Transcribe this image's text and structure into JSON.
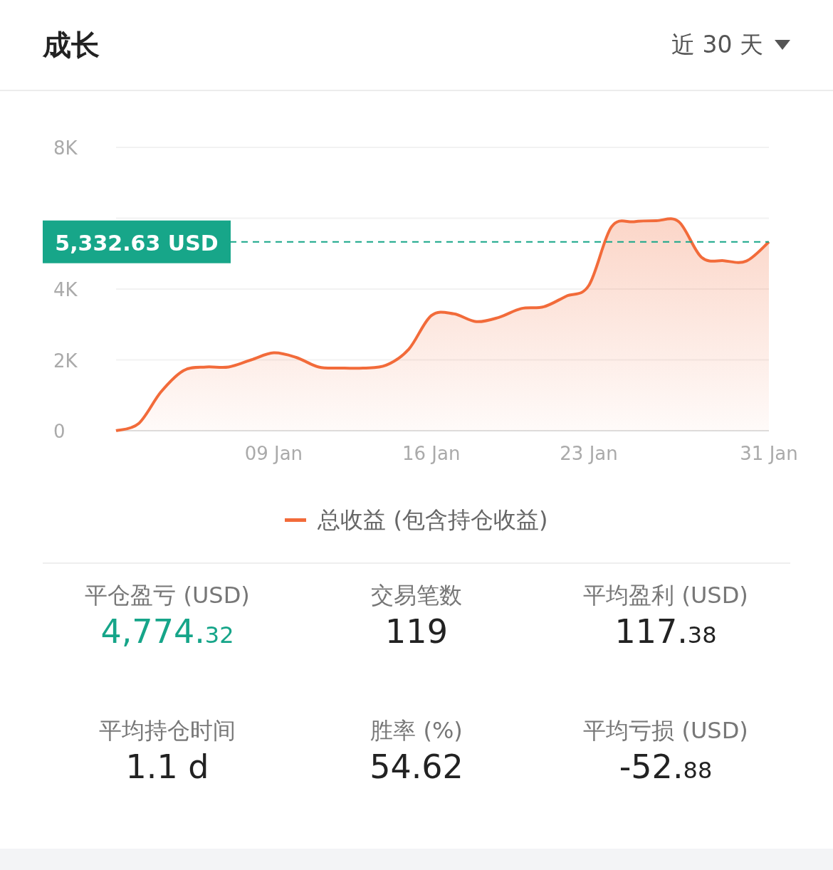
{
  "header": {
    "title": "成长",
    "period": "近 30 天"
  },
  "chart": {
    "chart_data": {
      "type": "area",
      "categories": [
        null,
        null,
        null,
        null,
        null,
        null,
        null,
        "09 Jan",
        null,
        null,
        null,
        null,
        null,
        null,
        "16 Jan",
        null,
        null,
        null,
        null,
        null,
        null,
        "23 Jan",
        null,
        null,
        null,
        null,
        null,
        null,
        null,
        "31 Jan"
      ],
      "series": [
        {
          "name": "总收益 (包含持仓收益)",
          "color": "#f26b3a",
          "values": [
            0,
            200,
            1100,
            1700,
            1800,
            1800,
            2000,
            2200,
            2070,
            1800,
            1770,
            1770,
            1850,
            2300,
            3250,
            3300,
            3080,
            3200,
            3450,
            3500,
            3800,
            4100,
            5750,
            5900,
            5930,
            5900,
            4900,
            4800,
            4790,
            5330
          ]
        }
      ],
      "ylim": [
        0,
        8000
      ],
      "yticks": [
        {
          "value": 0,
          "label": "0"
        },
        {
          "value": 2000,
          "label": "2K"
        },
        {
          "value": 4000,
          "label": "4K"
        },
        {
          "value": 8000,
          "label": "8K"
        }
      ],
      "ref_lines": [
        {
          "axis": "y",
          "value": 5332.63,
          "label": "5,332.63 USD",
          "color": "#17a689"
        }
      ]
    }
  },
  "stats": [
    {
      "label": "平仓盈亏 (USD)",
      "value": "4,774.",
      "fraction": "32",
      "color": "#16a589"
    },
    {
      "label": "交易笔数",
      "value": "119",
      "color": "#222222"
    },
    {
      "label": "平均盈利 (USD)",
      "value": "117.",
      "fraction": "38",
      "color": "#222222"
    },
    {
      "label": "平均持仓时间",
      "value": "1.1 d",
      "color": "#222222"
    },
    {
      "label": "胜率 (%)",
      "value": "54.62",
      "color": "#222222"
    },
    {
      "label": "平均亏损 (USD)",
      "value": "-52.",
      "fraction": "88",
      "color": "#222222"
    }
  ]
}
